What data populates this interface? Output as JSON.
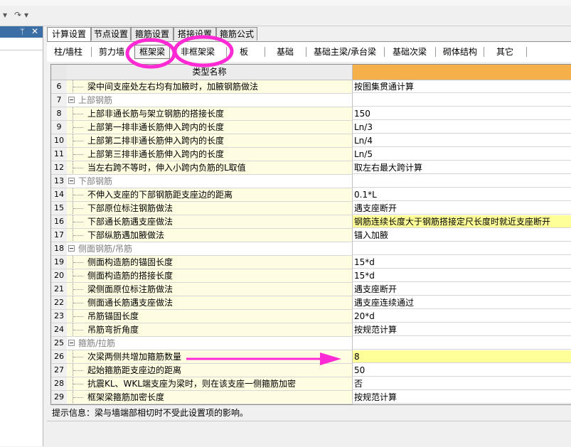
{
  "tabs": [
    "计算设置",
    "节点设置",
    "箍筋设置",
    "搭接设置",
    "箍筋公式"
  ],
  "subtabs": [
    "柱/墙柱",
    "剪力墙",
    "框架梁",
    "非框架梁",
    "板",
    "基础",
    "基础主梁/承台梁",
    "基础次梁",
    "砌体结构",
    "其它"
  ],
  "grid": {
    "header_name": "类型名称",
    "rows": [
      {
        "num": "6",
        "name": "梁中间支座处左右均有加腋时，加腋钢筋做法",
        "value": "按图集贯通计算",
        "group": false
      },
      {
        "num": "7",
        "name": "上部钢筋",
        "value": "",
        "group": true
      },
      {
        "num": "8",
        "name": "上部非通长筋与架立钢筋的搭接长度",
        "value": "150",
        "group": false
      },
      {
        "num": "9",
        "name": "上部第一排非通长筋伸入跨内的长度",
        "value": "Ln/3",
        "group": false
      },
      {
        "num": "10",
        "name": "上部第二排非通长筋伸入跨内的长度",
        "value": "Ln/4",
        "group": false
      },
      {
        "num": "11",
        "name": "上部第三排非通长筋伸入跨内的长度",
        "value": "Ln/5",
        "group": false
      },
      {
        "num": "12",
        "name": "当左右跨不等时，伸入小跨内负筋的L取值",
        "value": "取左右最大跨计算",
        "group": false
      },
      {
        "num": "13",
        "name": "下部钢筋",
        "value": "",
        "group": true
      },
      {
        "num": "14",
        "name": "不伸入支座的下部钢筋距支座边的距离",
        "value": "0.1*L",
        "group": false
      },
      {
        "num": "15",
        "name": "下部原位标注钢筋做法",
        "value": "遇支座断开",
        "group": false
      },
      {
        "num": "16",
        "name": "下部通长筋遇支座做法",
        "value": "钢筋连续长度大于钢筋搭接定尺长度时就近支座断开",
        "group": false,
        "highlight": true
      },
      {
        "num": "17",
        "name": "下部纵筋遇加腋做法",
        "value": "锚入加腋",
        "group": false
      },
      {
        "num": "18",
        "name": "侧面钢筋/吊筋",
        "value": "",
        "group": true
      },
      {
        "num": "19",
        "name": "侧面构造筋的锚固长度",
        "value": "15*d",
        "group": false
      },
      {
        "num": "20",
        "name": "侧面构造筋的搭接长度",
        "value": "15*d",
        "group": false
      },
      {
        "num": "21",
        "name": "梁侧面原位标注筋做法",
        "value": "遇支座断开",
        "group": false
      },
      {
        "num": "22",
        "name": "侧面通长筋遇支座做法",
        "value": "遇支座连续通过",
        "group": false
      },
      {
        "num": "23",
        "name": "吊筋锚固长度",
        "value": "20*d",
        "group": false
      },
      {
        "num": "24",
        "name": "吊筋弯折角度",
        "value": "按规范计算",
        "group": false
      },
      {
        "num": "25",
        "name": "箍筋/拉筋",
        "value": "",
        "group": true
      },
      {
        "num": "26",
        "name": "次梁两侧共增加箍筋数量",
        "value": "8",
        "group": false,
        "highlight": true
      },
      {
        "num": "27",
        "name": "起始箍筋距支座边的距离",
        "value": "50",
        "group": false
      },
      {
        "num": "28",
        "name": "抗震KL、WKL端支座为梁时，则在该支座一侧箍筋加密",
        "value": "否",
        "group": false
      },
      {
        "num": "29",
        "name": "框架梁箍筋加密长度",
        "value": "按规范计算",
        "group": false
      }
    ]
  },
  "hint": "提示信息：梁与墙端部相切时不受此设置项的影响。",
  "colors": {
    "annotation": "#ff2ad4",
    "header_value_bg": "#f6b04a",
    "highlight": "#ffff99",
    "name_bg": "#fefde2"
  },
  "icons": {
    "pin": "pin-icon",
    "close": "close-icon"
  }
}
